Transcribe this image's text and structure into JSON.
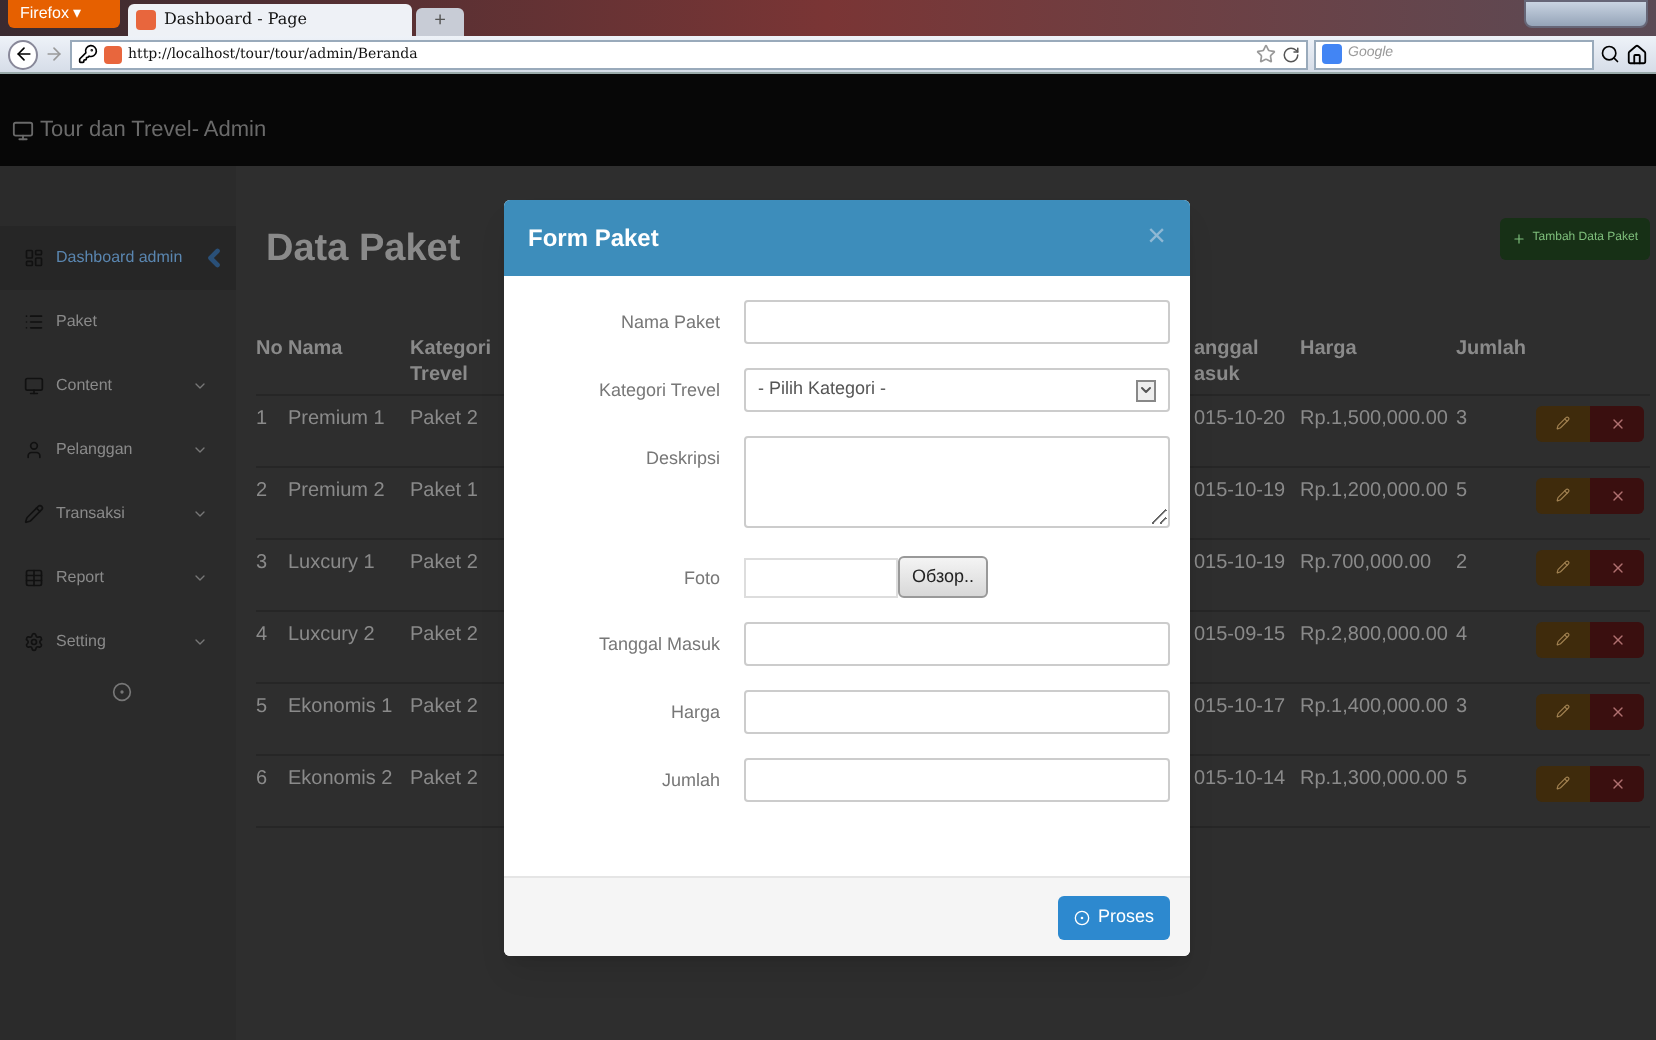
{
  "browser": {
    "menu_button": "Firefox ▾",
    "tab_title": "Dashboard - Page",
    "new_tab": "+",
    "url": "http://localhost/tour/tour/admin/Beranda",
    "search_placeholder": "Google"
  },
  "app": {
    "brand": "Tour dan Trevel- Admin"
  },
  "sidebar": {
    "items": [
      {
        "label": "Dashboard admin",
        "selected": true,
        "expandable": false
      },
      {
        "label": "Paket",
        "selected": false,
        "expandable": false
      },
      {
        "label": "Content",
        "selected": false,
        "expandable": true
      },
      {
        "label": "Pelanggan",
        "selected": false,
        "expandable": true
      },
      {
        "label": "Transaksi",
        "selected": false,
        "expandable": true
      },
      {
        "label": "Report",
        "selected": false,
        "expandable": true
      },
      {
        "label": "Setting",
        "selected": false,
        "expandable": true
      }
    ]
  },
  "page": {
    "title": "Data Paket",
    "add_button": "Tambah Data Paket"
  },
  "table": {
    "columns": [
      "No",
      "Nama",
      "Kategori Trevel",
      "anggal asuk",
      "Harga",
      "Jumlah"
    ],
    "rows": [
      [
        "1",
        "Premium 1",
        "Paket 2",
        "015-10-20",
        "Rp.1,500,000.00",
        "3"
      ],
      [
        "2",
        "Premium 2",
        "Paket 1",
        "015-10-19",
        "Rp.1,200,000.00",
        "5"
      ],
      [
        "3",
        "Luxcury 1",
        "Paket 2",
        "015-10-19",
        "Rp.700,000.00",
        "2"
      ],
      [
        "4",
        "Luxcury 2",
        "Paket 2",
        "015-09-15",
        "Rp.2,800,000.00",
        "4"
      ],
      [
        "5",
        "Ekonomis 1",
        "Paket 2",
        "015-10-17",
        "Rp.1,400,000.00",
        "3"
      ],
      [
        "6",
        "Ekonomis 2",
        "Paket 2",
        "015-10-14",
        "Rp.1,300,000.00",
        "5"
      ]
    ]
  },
  "modal": {
    "title": "Form Paket",
    "close": "×",
    "fields": [
      {
        "label": "Nama Paket",
        "kind": "text"
      },
      {
        "label": "Kategori Trevel",
        "kind": "select",
        "value": "- Pilih Kategori -"
      },
      {
        "label": "Deskripsi",
        "kind": "textarea"
      },
      {
        "label": "Foto",
        "kind": "file",
        "button": "Обзор.."
      },
      {
        "label": "Tanggal Masuk",
        "kind": "text"
      },
      {
        "label": "Harga",
        "kind": "text"
      },
      {
        "label": "Jumlah",
        "kind": "text"
      }
    ],
    "submit": "Proses"
  }
}
